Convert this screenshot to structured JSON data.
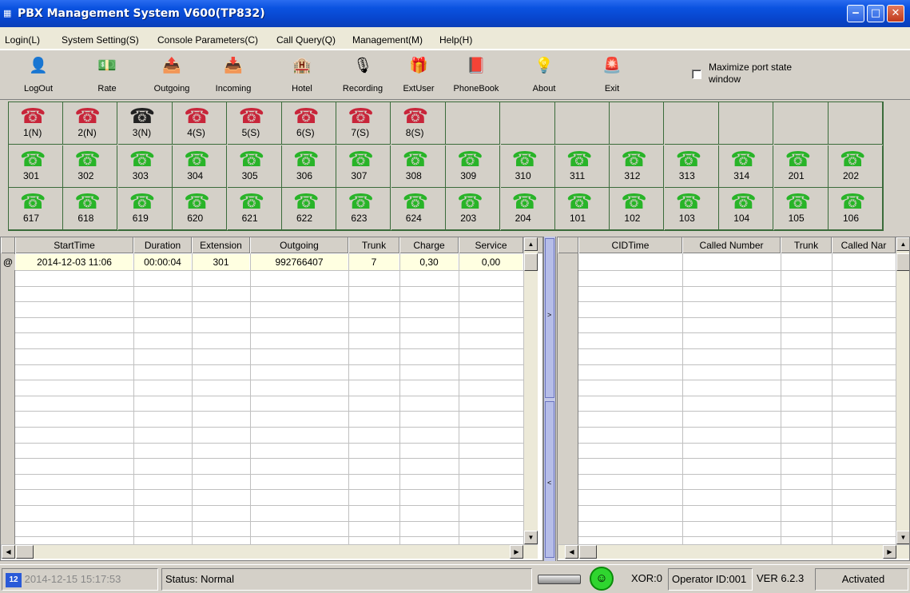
{
  "window": {
    "title": "PBX Management System V600(TP832)",
    "app_icon": "pbx-app-icon"
  },
  "menu": [
    "Login(L)",
    "System Setting(S)",
    "Console Parameters(C)",
    "Call Query(Q)",
    "Management(M)",
    "Help(H)"
  ],
  "toolbar": [
    {
      "label": "LogOut",
      "icon": "user-key-icon",
      "glyph": "👤"
    },
    {
      "label": "Rate",
      "icon": "rate-money-icon",
      "glyph": "💵"
    },
    {
      "label": "Outgoing",
      "icon": "outgoing-icon",
      "glyph": "📤"
    },
    {
      "label": "Incoming",
      "icon": "incoming-icon",
      "glyph": "📥"
    },
    {
      "label": "Hotel",
      "icon": "hotel-icon",
      "glyph": "🏨"
    },
    {
      "label": "Recording",
      "icon": "recording-icon",
      "glyph": "🎙"
    },
    {
      "label": "ExtUser",
      "icon": "ext-user-icon",
      "glyph": "🎁"
    },
    {
      "label": "PhoneBook",
      "icon": "phonebook-icon",
      "glyph": "📕"
    },
    {
      "label": "About",
      "icon": "lightbulb-icon",
      "glyph": "💡"
    },
    {
      "label": "Exit",
      "icon": "exit-icon",
      "glyph": "🚨"
    }
  ],
  "maximize_port_label": "Maximize port state window",
  "ports": {
    "row1": [
      {
        "n": "1(N)",
        "c": "red"
      },
      {
        "n": "2(N)",
        "c": "red"
      },
      {
        "n": "3(N)",
        "c": "black"
      },
      {
        "n": "4(S)",
        "c": "red"
      },
      {
        "n": "5(S)",
        "c": "red"
      },
      {
        "n": "6(S)",
        "c": "red"
      },
      {
        "n": "7(S)",
        "c": "red"
      },
      {
        "n": "8(S)",
        "c": "red"
      }
    ],
    "row2": [
      "301",
      "302",
      "303",
      "304",
      "305",
      "306",
      "307",
      "308",
      "309",
      "310",
      "311",
      "312",
      "313",
      "314",
      "201",
      "202"
    ],
    "row3": [
      "617",
      "618",
      "619",
      "620",
      "621",
      "622",
      "623",
      "624",
      "203",
      "204",
      "101",
      "102",
      "103",
      "104",
      "105",
      "106"
    ]
  },
  "outgoing": {
    "columns": [
      "StartTime",
      "Duration",
      "Extension",
      "Outgoing",
      "Trunk",
      "Charge",
      "Service"
    ],
    "row_marker": "@",
    "rows": [
      [
        "2014-12-03 11:06",
        "00:00:04",
        "301",
        "992766407",
        "7",
        "0,30",
        "0,00"
      ]
    ]
  },
  "incoming": {
    "columns": [
      "CIDTime",
      "Called Number",
      "Trunk",
      "Called Nar"
    ]
  },
  "splitter": {
    "right_arrow": ">",
    "left_arrow": "<"
  },
  "status": {
    "datetime": "2014-12-15 15:17:53",
    "status": "Status: Normal",
    "xor": "XOR:0",
    "operator": "Operator ID:001",
    "version": "VER 6.2.3",
    "activation": "Activated"
  },
  "colors": {
    "titlebar": "#0a52e0",
    "phone_green": "#28b428",
    "phone_red": "#c8253a",
    "row_highlight": "#ffffe1"
  }
}
